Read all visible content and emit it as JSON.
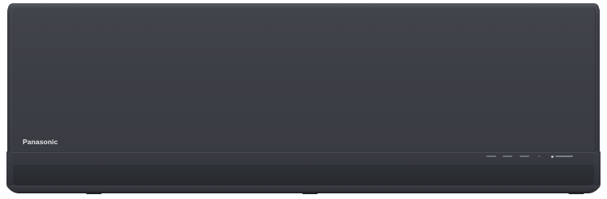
{
  "product": {
    "brand_name": "Panasonic",
    "body_color": "#3b3e44",
    "louver_color": "#2a2d32"
  },
  "indicators": {
    "icons": [
      "status-light-icon",
      "status-light-icon",
      "status-light-icon",
      "status-light-icon",
      "badge-icon"
    ]
  }
}
